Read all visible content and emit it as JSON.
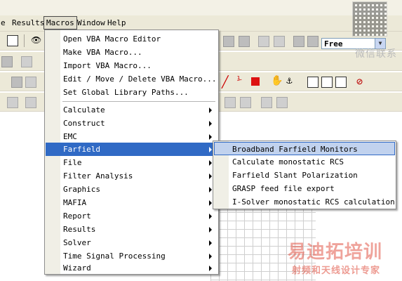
{
  "menubar": {
    "items": [
      {
        "label": "e"
      },
      {
        "label": "Results"
      },
      {
        "label": "Macros"
      },
      {
        "label": "Window"
      },
      {
        "label": "Help"
      }
    ]
  },
  "toolbar": {
    "mode_combo": "Free"
  },
  "macros_menu": {
    "items": [
      {
        "label": "Open VBA Macro Editor"
      },
      {
        "label": "Make VBA Macro..."
      },
      {
        "label": "Import VBA Macro..."
      },
      {
        "label": "Edit / Move / Delete VBA Macro..."
      },
      {
        "label": "Set Global Library Paths..."
      },
      {
        "label": "Calculate"
      },
      {
        "label": "Construct"
      },
      {
        "label": "EMC"
      },
      {
        "label": "Farfield"
      },
      {
        "label": "File"
      },
      {
        "label": "Filter Analysis"
      },
      {
        "label": "Graphics"
      },
      {
        "label": "MAFIA"
      },
      {
        "label": "Report"
      },
      {
        "label": "Results"
      },
      {
        "label": "Solver"
      },
      {
        "label": "Time Signal Processing"
      },
      {
        "label": "Wizard"
      }
    ]
  },
  "farfield_submenu": {
    "items": [
      {
        "label": "Broadband Farfield Monitors"
      },
      {
        "label": "Calculate monostatic RCS"
      },
      {
        "label": "Farfield Slant Polarization"
      },
      {
        "label": "GRASP feed file export"
      },
      {
        "label": "I-Solver monostatic RCS calculation"
      }
    ]
  },
  "watermark": {
    "wechat_text": "微信联系",
    "brand_part1": "易迪拓",
    "brand_part2": "培训",
    "brand_tagline": "射频和天线设计专家"
  },
  "colors": {
    "menu_highlight": "#306ac5",
    "submenu_highlight": "#c1d2ee",
    "toolbar_bg": "#ece9d8",
    "watermark_red": "#e04a3a"
  }
}
